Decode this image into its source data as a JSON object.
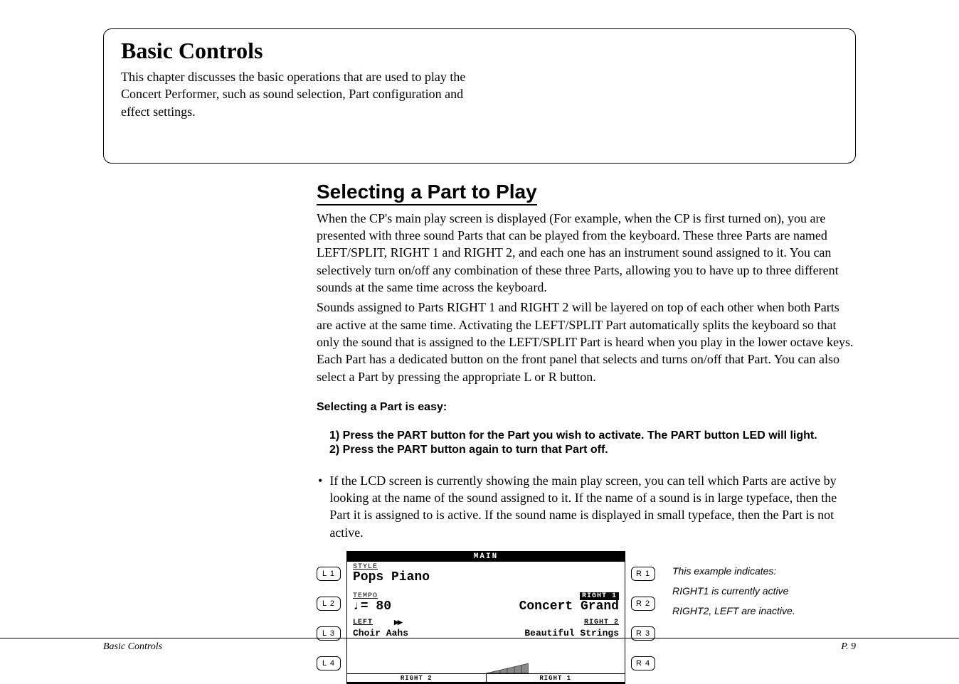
{
  "intro": {
    "title": "Basic Controls",
    "text": "This chapter discusses the basic operations that are used to play the Concert Performer, such as sound selection, Part configuration and effect settings."
  },
  "section": {
    "heading": "Selecting a Part to Play",
    "para1": "When the CP's main play screen is displayed (For example, when the CP is first turned on), you are presented with three sound Parts that can be played from the keyboard.  These three Parts are named LEFT/SPLIT, RIGHT 1 and RIGHT 2, and each one has an instrument sound assigned to it.  You can selectively turn on/off any combination of these three Parts, allowing you to have up to three different sounds at the same time across the keyboard.",
    "para2": "Sounds assigned to Parts RIGHT 1 and RIGHT 2 will be layered on top of each other when both Parts are active at the same time.  Activating the LEFT/SPLIT Part automatically splits the keyboard so that only the sound that is assigned to the LEFT/SPLIT Part is heard when you play in the lower octave keys.  Each Part has a dedicated button on the front panel that selects and turns on/off that Part.  You can also select a Part by pressing the appropriate L or R button.",
    "subheading": "Selecting a Part is easy:",
    "step1": "1)  Press the PART button for the Part you wish to activate.  The PART button LED will light.",
    "step2": "2)  Press the PART button again to turn that Part off.",
    "bullet": "If the LCD screen is currently showing the main play screen, you can tell which Parts are active by looking at the name of the sound assigned to it.  If the name of a sound is in large typeface, then the Part it is assigned to is active.  If the sound name is displayed in small typeface, then the Part is not active."
  },
  "lcd": {
    "title": "MAIN",
    "style_label": "STYLE",
    "style_value": "Pops Piano",
    "tempo_label": "TEMPO",
    "tempo_value": "♩= 80",
    "right1_label": "RIGHT 1",
    "right1_value": "Concert Grand",
    "left_label": "LEFT",
    "left_value": "Choir Aahs",
    "right2_label": "RIGHT 2",
    "right2_value": "Beautiful Strings",
    "bottom_left": "RIGHT 2",
    "bottom_right": "RIGHT 1",
    "buttons_left": [
      "L 1",
      "L 2",
      "L 3",
      "L 4"
    ],
    "buttons_right": [
      "R 1",
      "R 2",
      "R 3",
      "R 4"
    ]
  },
  "annotations": {
    "line1": "This example indicates:",
    "line2": "RIGHT1 is currently active",
    "line3": "RIGHT2, LEFT are inactive."
  },
  "footer": {
    "left": "Basic Controls",
    "right": "P. 9"
  }
}
